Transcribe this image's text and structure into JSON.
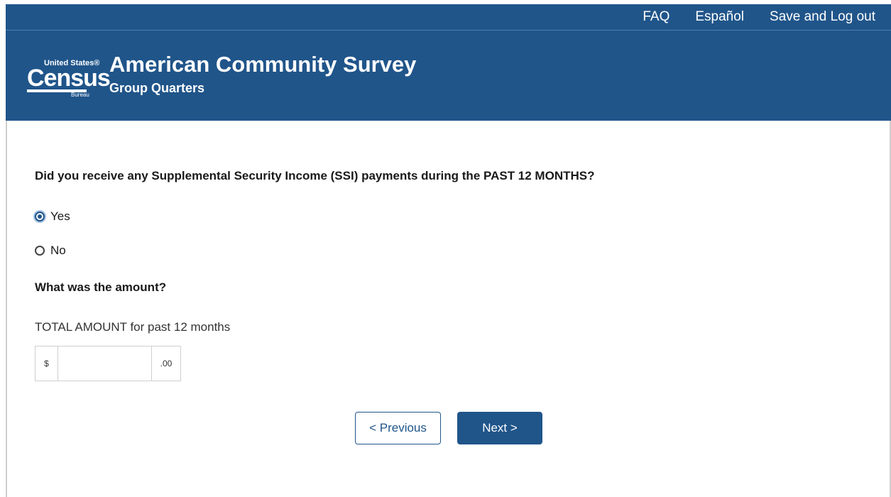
{
  "topnav": {
    "faq": "FAQ",
    "espanol": "Español",
    "logout": "Save and Log out"
  },
  "header": {
    "logo": {
      "united_states": "United States®",
      "census": "Census",
      "bureau": "Bureau"
    },
    "title": "American Community Survey",
    "subtitle": "Group Quarters"
  },
  "form": {
    "question": "Did you receive any Supplemental Security Income (SSI) payments during the PAST 12 MONTHS?",
    "options": [
      {
        "label": "Yes",
        "selected": true
      },
      {
        "label": "No",
        "selected": false
      }
    ],
    "amount_question": "What was the amount?",
    "amount_label": "TOTAL AMOUNT for past 12 months",
    "amount_prefix": "$",
    "amount_value": "",
    "amount_suffix": ".00"
  },
  "buttons": {
    "previous": "< Previous",
    "next": "Next >"
  },
  "colors": {
    "brand_blue": "#20558a"
  }
}
